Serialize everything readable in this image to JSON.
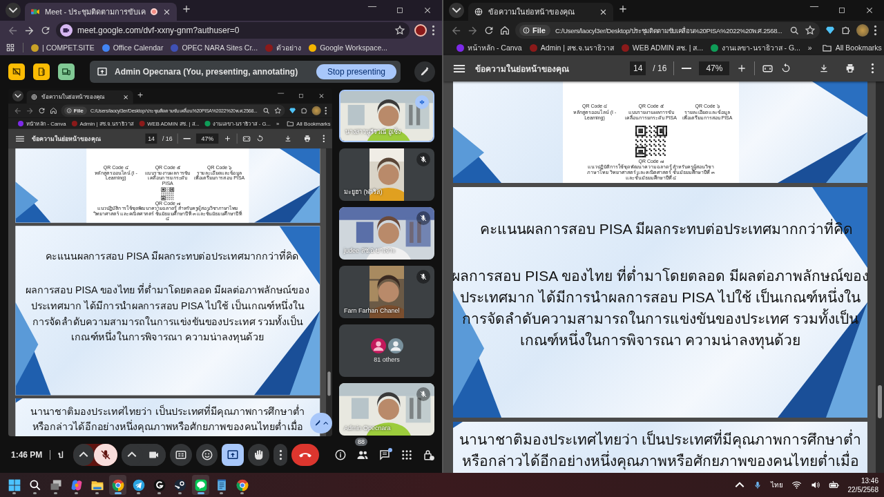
{
  "meet_window": {
    "tab_title": "Meet - ประชุมติดตามการขับเค",
    "recording": true,
    "url": "meet.google.com/dvf-xxny-gnm?authuser=0",
    "bookmarks": [
      {
        "label": "| COMPET.SITE",
        "color": "#c9a227"
      },
      {
        "label": "Office Calendar",
        "color": "#4285f4"
      },
      {
        "label": "OPEC NARA Sites Cr...",
        "color": "#3f51b5"
      },
      {
        "label": "ตัวอย่าง",
        "color": "#8b1a1a"
      },
      {
        "label": "Google Workspace...",
        "color": "#f4b400"
      }
    ]
  },
  "presenting_bar": {
    "text": "Admin Opecnara (You, presenting, annotating)",
    "button": "Stop presenting"
  },
  "shared_screen": {
    "tab_title": "ข้อความในย่อหน้าของคุณ",
    "url_chip": "File",
    "url": "C:/Users/laocyl3er/Desktop/ประชุมติดตามขับเคลื่อน%20PISA%2022%20พ.ศ.2568...",
    "bookmarks": [
      {
        "label": "หน้าหลัก - Canva",
        "color": "#7d2ae8"
      },
      {
        "label": "Admin | สช.จ.นราธิวาส",
        "color": "#8b1a1a"
      },
      {
        "label": "WEB ADMIN สช. | ส...",
        "color": "#8b1a1a"
      },
      {
        "label": "งานเลขา-นราธิวาส - G...",
        "color": "#0f9d58"
      }
    ],
    "more_bookmarks": "»",
    "all_bookmarks": "All Bookmarks",
    "doc_title": "ข้อความในย่อหน้าของคุณ",
    "page": "14",
    "page_total": "/ 16",
    "zoom": "47%",
    "slides": [
      {
        "kind": "qr",
        "captions": [
          {
            "title": "QR Code ๔",
            "text": "หลักสูตรออนไลน์ (I - Learning)"
          },
          {
            "title": "QR Code ๕",
            "text": "แบบรายงานผลการขับเคลื่อนการยกระดับ PISA"
          },
          {
            "title": "QR Code ๖",
            "text": "รายละเอียดและข้อมูลเพื่อเตรียมการสอบ PISA"
          }
        ],
        "center": {
          "title": "QR Code ๗",
          "text": "แนวปฏิบัติการใช้ชุดพัฒนาความฉลาดรู้ สำหรับครูผู้สอนวิชาภาษาไทย วิทยาศาสตร์ และคณิตศาสตร์ ชั้นมัธยมศึกษาปีที่ ๓ และชั้นมัธยมศึกษาปีที่ ๔"
        }
      },
      {
        "kind": "text",
        "heading": "คะแนนผลการสอบ PISA มีผลกระทบต่อประเทศมากกว่าที่คิด",
        "lines": [
          "ผลการสอบ PISA ของไทย ที่ต่ำมาโดยตลอด มีผลต่อภาพลักษณ์ของ",
          "ประเทศมาก ได้มีการนำผลการสอบ PISA ไปใช้ เป็นเกณฑ์หนึ่งใน",
          "การจัดลำดับความสามารถในการแข่งขันของประเทศ รวมทั้งเป็น",
          "เกณฑ์หนึ่งในการพิจารณา ความน่าลงทุนด้วย"
        ]
      },
      {
        "kind": "text",
        "lines": [
          "นานาชาติมองประเทศไทยว่า เป็นประเทศที่มีคุณภาพการศึกษาต่ำ",
          "หรือกล่าวได้อีกอย่างหนึ่งคุณภาพหรือศักยภาพของคนไทยต่ำเมื่อ"
        ]
      }
    ]
  },
  "participants": [
    {
      "kind": "video",
      "name": "นางสาวนูรีรวณี อูเซ็ง",
      "speaking": true,
      "muted": false
    },
    {
      "kind": "portrait",
      "name": "มะยูฮา (ฟาริส)",
      "speaking": false,
      "muted": true
    },
    {
      "kind": "video",
      "name": "judee สช.อ.บาเจาะ",
      "speaking": false,
      "muted": true
    },
    {
      "kind": "portrait",
      "name": "Farn Farhan Chanel",
      "speaking": false,
      "muted": true
    },
    {
      "kind": "others",
      "name": "81 others"
    },
    {
      "kind": "video",
      "name": "Admin Opecnara",
      "speaking": false,
      "muted": true
    }
  ],
  "call_controls": {
    "time": "1:46 PM",
    "meeting_name": "ป",
    "mic_on": false,
    "people_count": "88",
    "chat_unread": true
  },
  "pdf_window": {
    "tab_title": "ข้อความในย่อหน้าของคุณ",
    "url_chip": "File",
    "url": "C:/Users/laocyl3er/Desktop/ประชุมติดตามขับเคลื่อน%20PISA%2022%20พ.ศ.2568...",
    "bookmarks": [
      {
        "label": "หน้าหลัก - Canva",
        "color": "#7d2ae8"
      },
      {
        "label": "Admin | สช.จ.นราธิวาส",
        "color": "#8b1a1a"
      },
      {
        "label": "WEB ADMIN สช. | ส...",
        "color": "#8b1a1a"
      },
      {
        "label": "งานเลขา-นราธิวาส - G...",
        "color": "#0f9d58"
      }
    ],
    "more_bookmarks": "»",
    "all_bookmarks": "All Bookmarks",
    "doc_title": "ข้อความในย่อหน้าของคุณ",
    "page": "14",
    "page_total": "/ 16",
    "zoom": "47%",
    "slides": [
      {
        "kind": "qr",
        "captions": [
          {
            "title": "QR Code ๔",
            "text": "หลักสูตรออนไลน์ (I - Learning)"
          },
          {
            "title": "QR Code ๕",
            "text": "แบบรายงานผลการขับเคลื่อนการยกระดับ PISA"
          },
          {
            "title": "QR Code ๖",
            "text": "รายละเอียดและข้อมูลเพื่อเตรียมการสอบ PISA"
          }
        ],
        "center": {
          "title": "QR Code ๗",
          "text": "แนวปฏิบัติการใช้ชุดพัฒนาความฉลาดรู้ สำหรับครูผู้สอนวิชาภาษาไทย วิทยาศาสตร์ และคณิตศาสตร์ ชั้นมัธยมศึกษาปีที่ ๓ และชั้นมัธยมศึกษาปีที่ ๔"
        }
      },
      {
        "kind": "text",
        "heading": "คะแนนผลการสอบ PISA มีผลกระทบต่อประเทศมากกว่าที่คิด",
        "lines": [
          "ผลการสอบ PISA ของไทย ที่ต่ำมาโดยตลอด มีผลต่อภาพลักษณ์ของ",
          "ประเทศมาก ได้มีการนำผลการสอบ PISA ไปใช้ เป็นเกณฑ์หนึ่งใน",
          "การจัดลำดับความสามารถในการแข่งขันของประเทศ รวมทั้งเป็น",
          "เกณฑ์หนึ่งในการพิจารณา ความน่าลงทุนด้วย"
        ]
      },
      {
        "kind": "text",
        "lines": [
          "นานาชาติมองประเทศไทยว่า เป็นประเทศที่มีคุณภาพการศึกษาต่ำ",
          "หรือกล่าวได้อีกอย่างหนึ่งคุณภาพหรือศักยภาพของคนไทยต่ำเมื่อ"
        ]
      }
    ]
  },
  "taskbar": {
    "apps": [
      {
        "kind": "start",
        "active": false
      },
      {
        "kind": "search",
        "active": false
      },
      {
        "kind": "taskview",
        "active": false
      },
      {
        "kind": "copilot",
        "active": false
      },
      {
        "kind": "explorer",
        "active": false
      },
      {
        "kind": "chrome",
        "active": true
      },
      {
        "kind": "telegram",
        "active": false
      },
      {
        "kind": "ghub",
        "active": false
      },
      {
        "kind": "steam",
        "active": false
      },
      {
        "kind": "line",
        "active": true
      },
      {
        "kind": "notepad",
        "active": false
      },
      {
        "kind": "chrome",
        "active": false
      }
    ],
    "language": "ไทย",
    "time": "13:46",
    "date": "22/5/2568"
  }
}
